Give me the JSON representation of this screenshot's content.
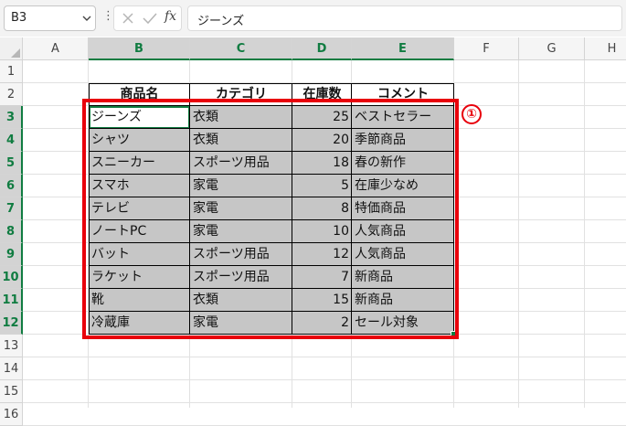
{
  "formula_bar": {
    "name_box": "B3",
    "more_glyph": "⋮",
    "fx_label": "fx",
    "formula": "ジーンズ"
  },
  "columns": [
    "A",
    "B",
    "C",
    "D",
    "E",
    "F",
    "G",
    "H"
  ],
  "rows": [
    "1",
    "2",
    "3",
    "4",
    "5",
    "6",
    "7",
    "8",
    "9",
    "10",
    "11",
    "12",
    "13",
    "14",
    "15",
    "16"
  ],
  "selection": {
    "active_cell": "B3",
    "range": "B3:E12",
    "selected_columns": [
      "B",
      "C",
      "D",
      "E"
    ],
    "selected_rows": [
      "3",
      "4",
      "5",
      "6",
      "7",
      "8",
      "9",
      "10",
      "11",
      "12"
    ]
  },
  "table": {
    "headers": [
      "商品名",
      "カテゴリ",
      "在庫数",
      "コメント"
    ],
    "rows": [
      [
        "ジーンズ",
        "衣類",
        "25",
        "ベストセラー"
      ],
      [
        "シャツ",
        "衣類",
        "20",
        "季節商品"
      ],
      [
        "スニーカー",
        "スポーツ用品",
        "18",
        "春の新作"
      ],
      [
        "スマホ",
        "家電",
        "5",
        "在庫少なめ"
      ],
      [
        "テレビ",
        "家電",
        "8",
        "特価商品"
      ],
      [
        "ノートPC",
        "家電",
        "10",
        "人気商品"
      ],
      [
        "バット",
        "スポーツ用品",
        "12",
        "人気商品"
      ],
      [
        "ラケット",
        "スポーツ用品",
        "7",
        "新商品"
      ],
      [
        "靴",
        "衣類",
        "15",
        "新商品"
      ],
      [
        "冷蔵庫",
        "家電",
        "2",
        "セール対象"
      ]
    ]
  },
  "annotation": {
    "marker": "①",
    "color": "#e8000b"
  },
  "colors": {
    "accent": "#107c41",
    "selection_fill": "#c6c6c6"
  }
}
